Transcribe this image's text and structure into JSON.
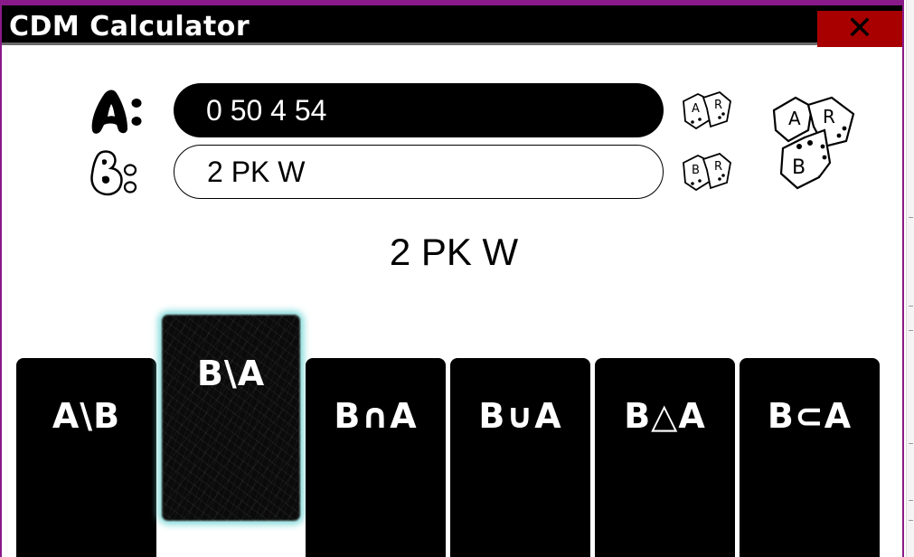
{
  "window": {
    "title": "CDM Calculator",
    "close_glyph": "✕"
  },
  "inputs": {
    "a": {
      "label_icon": "bubble-letter-a-icon",
      "value": "0 50 4 54"
    },
    "b": {
      "label_icon": "bubble-letter-b-icon",
      "value": "2 PK W"
    }
  },
  "dice": {
    "a_random_icon": "dice-icon",
    "a_die_letters": [
      "A",
      "R"
    ],
    "b_random_icon": "dice-icon",
    "b_die_letters": [
      "B",
      "R"
    ],
    "big_die_letters": [
      "A",
      "R",
      "B"
    ]
  },
  "result": "2 PK W",
  "operations": [
    {
      "label": "A\\B",
      "active": false
    },
    {
      "label": "B\\A",
      "active": true
    },
    {
      "label": "B∩A",
      "active": false
    },
    {
      "label": "B∪A",
      "active": false
    },
    {
      "label": "B△A",
      "active": false
    },
    {
      "label": "B⊂A",
      "active": false
    }
  ],
  "colors": {
    "accent": "#8a1a8a",
    "close": "#a80000",
    "glow": "#7fd9d9"
  }
}
